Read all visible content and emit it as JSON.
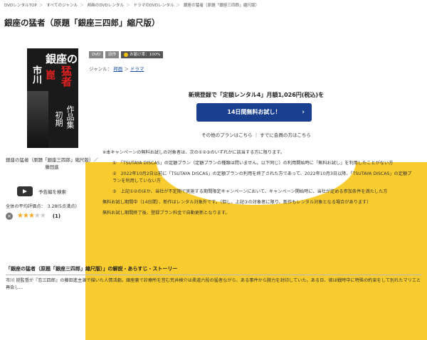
{
  "breadcrumb": {
    "items": [
      "DVDレンタルTOP",
      "すべてのジャンル",
      "邦画のDVDレンタル",
      "ドラマのDVDレンタル",
      "銀座の猛者（原題「銀座三四郎」縮尺版）"
    ],
    "separator": "＞"
  },
  "title": "銀座の猛者（原題「銀座三四郎」縮尺版）",
  "cover": {
    "line1": "銀座の",
    "line2": "猛者",
    "line3": "市川",
    "line4": "崑",
    "line5": "作品集",
    "line6": "初期"
  },
  "caption": "銀座の猛者（原題「銀座三四郎」縮尺版）／藤田進",
  "trailer_label": "予告編を検索",
  "avg_rating_text": "全体の平均評価点：　3.28(5点満点)",
  "rating": {
    "stars_on": 3,
    "stars_total": 5,
    "count": "(1)",
    "no_icon": "×"
  },
  "badges": {
    "format": "DVD",
    "type": "旧作",
    "reach_label": "お届け率：100%"
  },
  "genre": {
    "label": "ジャンル：",
    "items": [
      "邦画",
      "ドラマ"
    ]
  },
  "promo": {
    "register_text": "新規登録で「定額レンタル4」月額1,026円(税込)を",
    "cta_label": "14日間無料お試し！",
    "links": [
      "その他のプランはこちら",
      "すでに会員の方はこちら"
    ],
    "terms": [
      "※本キャンペーンの無料お試しの対象者は、次の①②③のいずれかに該当する方に限ります。",
      "①　「TSUTAYA DISCAS」の定額プラン（定額プランの種類は問いません。以下同じ）の利用開始時に「無料お試し」を利用したことがない方",
      "②　2022年10月2日以前に「TSUTAYA DISCAS」の定額プランの利用を終了された方であって、2022年10月3日以降、「TSUTAYA DISCAS」の定額プランを利用していない方",
      "③　上記①②のほか、当社が不定期で実施する期間限定キャンペーンにおいて、キャンペーン開始時に、当社が定める参加条件を満たした方",
      "無料お試し期間中（14日間）、新作はレンタル対象外です。（但し、上記③の対象者に限り、新作もレンタル対象となる場合があります）",
      "無料お試し期間終了後、登録プラン料金で自動更新となります。"
    ]
  },
  "section_head": "「銀座の猛者（原題「銀座三四郎」縮尺版）」の解説・あらすじ・ストーリー",
  "story": "市川 崑監督が『恋三四郎』の藤田進主演で描いた人情活劇。銀座裏で診療所を営む荒井検介は柔道六段の猛者ながら、ある事件から腕力を封印していた。ある日、彼は戦時中に特殊の約束をして別れたマリエと再会し…",
  "colors": {
    "accent": "#1a3f8f",
    "promo_bg": "#f8cb2e",
    "star": "#f5a623"
  }
}
